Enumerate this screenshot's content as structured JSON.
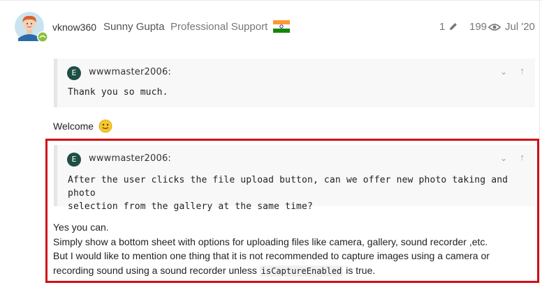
{
  "post": {
    "username": "vknow360",
    "full_name": "Sunny Gupta",
    "user_title": "Professional Support",
    "flag_icon": "india-flag-icon",
    "edits": "1",
    "views": "199",
    "date": "Jul '20"
  },
  "quote1": {
    "avatar_letter": "E",
    "author": "wwwmaster2006:",
    "text": "Thank you so much."
  },
  "welcome_text": "Welcome",
  "quote2": {
    "avatar_letter": "E",
    "author": "wwwmaster2006:",
    "text_line1": "After the user clicks the file upload button, can we offer new photo taking and photo",
    "text_line2": "selection from the gallery at the same time?"
  },
  "reply": {
    "line1": "Yes you can.",
    "line2": "Simply show a bottom sheet with options for uploading files like camera, gallery, sound recorder ,etc.",
    "line3": "But I would like to mention one thing that it is not recommended to capture images using a camera or",
    "line4_pre": "recording sound using a sound recorder unless ",
    "line4_code": "isCaptureEnabled",
    "line4_post": " is true."
  },
  "colors": {
    "highlight_border": "#d10f16",
    "quote_avatar": "#1d4f44"
  }
}
